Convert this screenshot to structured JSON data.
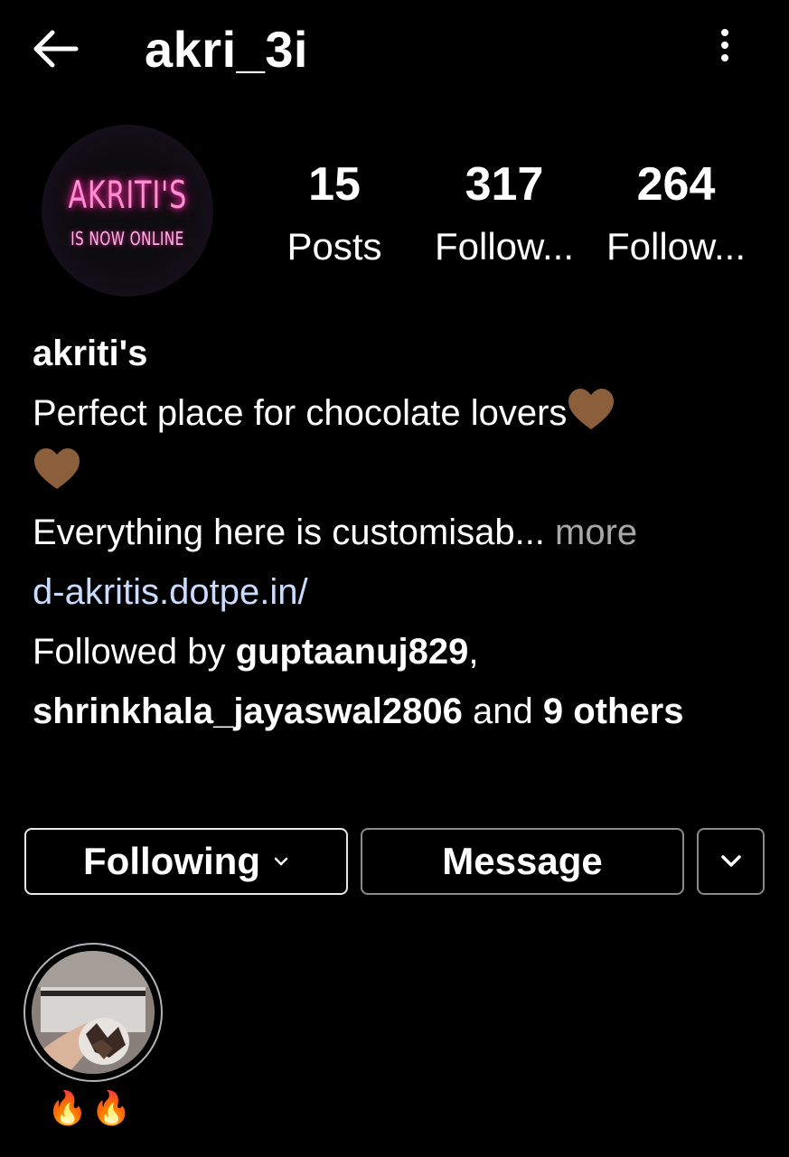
{
  "header": {
    "username": "akri_3i"
  },
  "avatar": {
    "title": "AKRITI'S",
    "subtitle": "IS NOW ONLINE"
  },
  "stats": {
    "posts": {
      "value": "15",
      "label": "Posts"
    },
    "followers": {
      "value": "317",
      "label": "Follow..."
    },
    "following": {
      "value": "264",
      "label": "Follow..."
    }
  },
  "bio": {
    "name": "akriti's",
    "line1": "Perfect place for chocolate lovers",
    "line2": "Everything here is customisab...",
    "more": "more",
    "link": "d-akritis.dotpe.in/",
    "followed_prefix": "Followed by",
    "followed_user1": "guptaanuj829",
    "followed_comma": ",",
    "followed_user2": "shrinkhala_jayaswal2806",
    "followed_and": "and",
    "followed_others": "9 others",
    "heart_color": "#8b5e3c"
  },
  "buttons": {
    "following": "Following",
    "message": "Message"
  },
  "highlight": {
    "label": "🔥🔥"
  },
  "colors": {
    "background": "#000000",
    "link": "#c9dcff",
    "muted": "#a8a8a8"
  }
}
